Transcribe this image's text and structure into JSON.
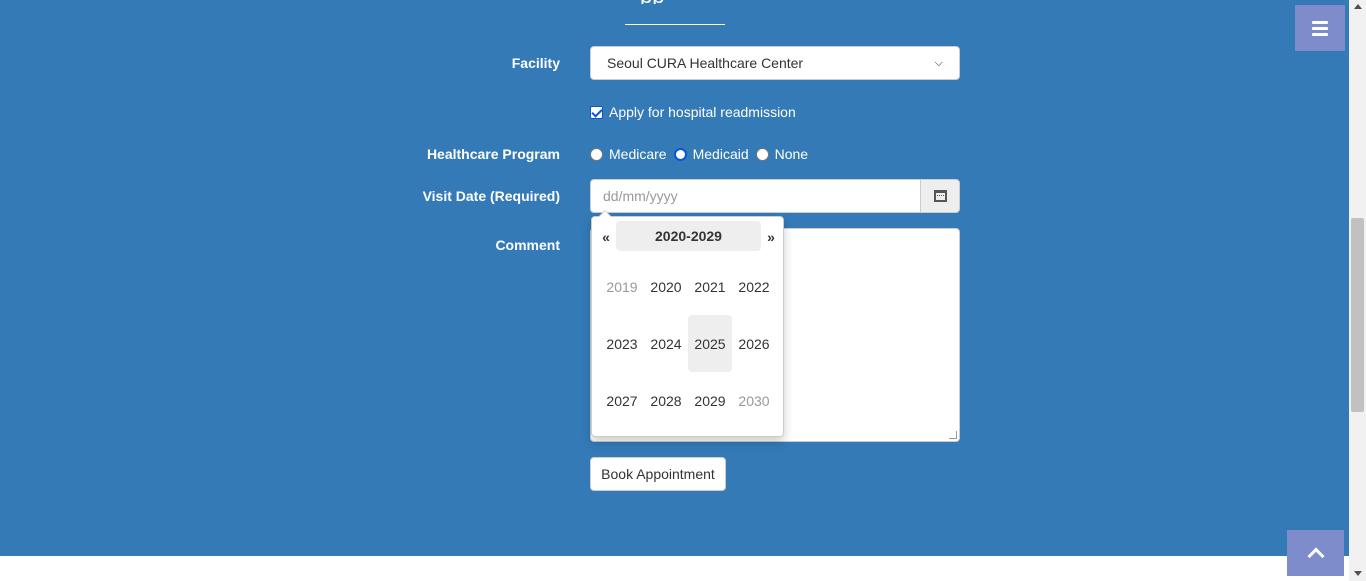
{
  "header": {
    "title_fragment": "pp"
  },
  "form": {
    "facility_label": "Facility",
    "facility_value": "Seoul CURA Healthcare Center",
    "readmission_label": "Apply for hospital readmission",
    "program_label": "Healthcare Program",
    "programs": [
      {
        "label": "Medicare",
        "selected": false
      },
      {
        "label": "Medicaid",
        "selected": true
      },
      {
        "label": "None",
        "selected": false
      }
    ],
    "visit_date_label": "Visit Date (Required)",
    "visit_date_placeholder": "dd/mm/yyyy",
    "comment_label": "Comment",
    "book_button": "Book Appointment"
  },
  "datepicker": {
    "prev": "«",
    "next": "»",
    "range": "2020-2029",
    "years": [
      {
        "label": "2019",
        "muted": true,
        "active": false
      },
      {
        "label": "2020",
        "muted": false,
        "active": false
      },
      {
        "label": "2021",
        "muted": false,
        "active": false
      },
      {
        "label": "2022",
        "muted": false,
        "active": false
      },
      {
        "label": "2023",
        "muted": false,
        "active": false
      },
      {
        "label": "2024",
        "muted": false,
        "active": false
      },
      {
        "label": "2025",
        "muted": false,
        "active": true
      },
      {
        "label": "2026",
        "muted": false,
        "active": false
      },
      {
        "label": "2027",
        "muted": false,
        "active": false
      },
      {
        "label": "2028",
        "muted": false,
        "active": false
      },
      {
        "label": "2029",
        "muted": false,
        "active": false
      },
      {
        "label": "2030",
        "muted": true,
        "active": false
      }
    ]
  },
  "colors": {
    "section_bg": "#337ab7",
    "nav_button_bg": "#7f8ccc",
    "checkbox_accent": "#0b57d0"
  },
  "icons": {
    "menu": "menu-icon",
    "calendar": "calendar-icon",
    "to_top": "chevron-up-icon"
  }
}
